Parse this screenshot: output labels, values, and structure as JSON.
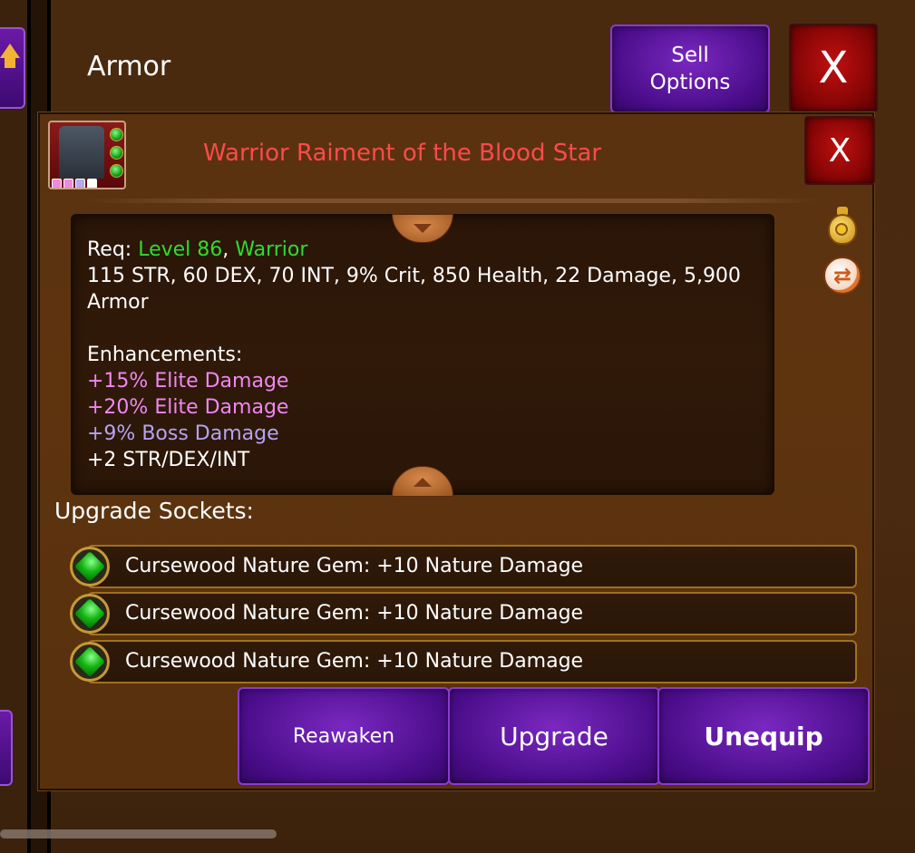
{
  "header": {
    "title": "Armor",
    "sell_options_label": "Sell\nOptions",
    "close_label": "X"
  },
  "item": {
    "name": "Warrior Raiment of the Blood Star",
    "close_label": "X",
    "icon": "armor-chest-icon",
    "gem_count": 3,
    "socket_colors": [
      "#f08ad8",
      "#f08ad8",
      "#b8a8f0",
      "#ffffff"
    ]
  },
  "stats": {
    "req_prefix": "Req: ",
    "req_level": "Level 86",
    "req_sep": ", ",
    "req_class": "Warrior",
    "attributes_line1": "115 STR, 60 DEX, 70 INT, 9% Crit, 850 Health, 22 Damage, 5,900",
    "attributes_line2": "Armor",
    "enhancements_label": "Enhancements:",
    "enhancements": [
      {
        "text": "+15% Elite Damage",
        "color": "#ee88f0"
      },
      {
        "text": "+20% Elite Damage",
        "color": "#ee88f0"
      },
      {
        "text": "+9% Boss Damage",
        "color": "#b4a4f0"
      },
      {
        "text": "+2 STR/DEX/INT",
        "color": "#ffffff"
      }
    ]
  },
  "side_icons": [
    "coin-bag-icon",
    "swap-icon"
  ],
  "sockets": {
    "label": "Upgrade Sockets:",
    "items": [
      {
        "text": "Cursewood Nature Gem: +10 Nature Damage"
      },
      {
        "text": "Cursewood Nature Gem: +10 Nature Damage"
      },
      {
        "text": "Cursewood Nature Gem: +10 Nature Damage"
      }
    ]
  },
  "actions": {
    "reawaken": "Reawaken",
    "upgrade": "Upgrade",
    "unequip": "Unequip"
  },
  "colors": {
    "item_name": "#ff4a4a",
    "requirement": "#2fdc2f",
    "button_purple": "#4a0d8a",
    "button_red": "#8a0606"
  }
}
